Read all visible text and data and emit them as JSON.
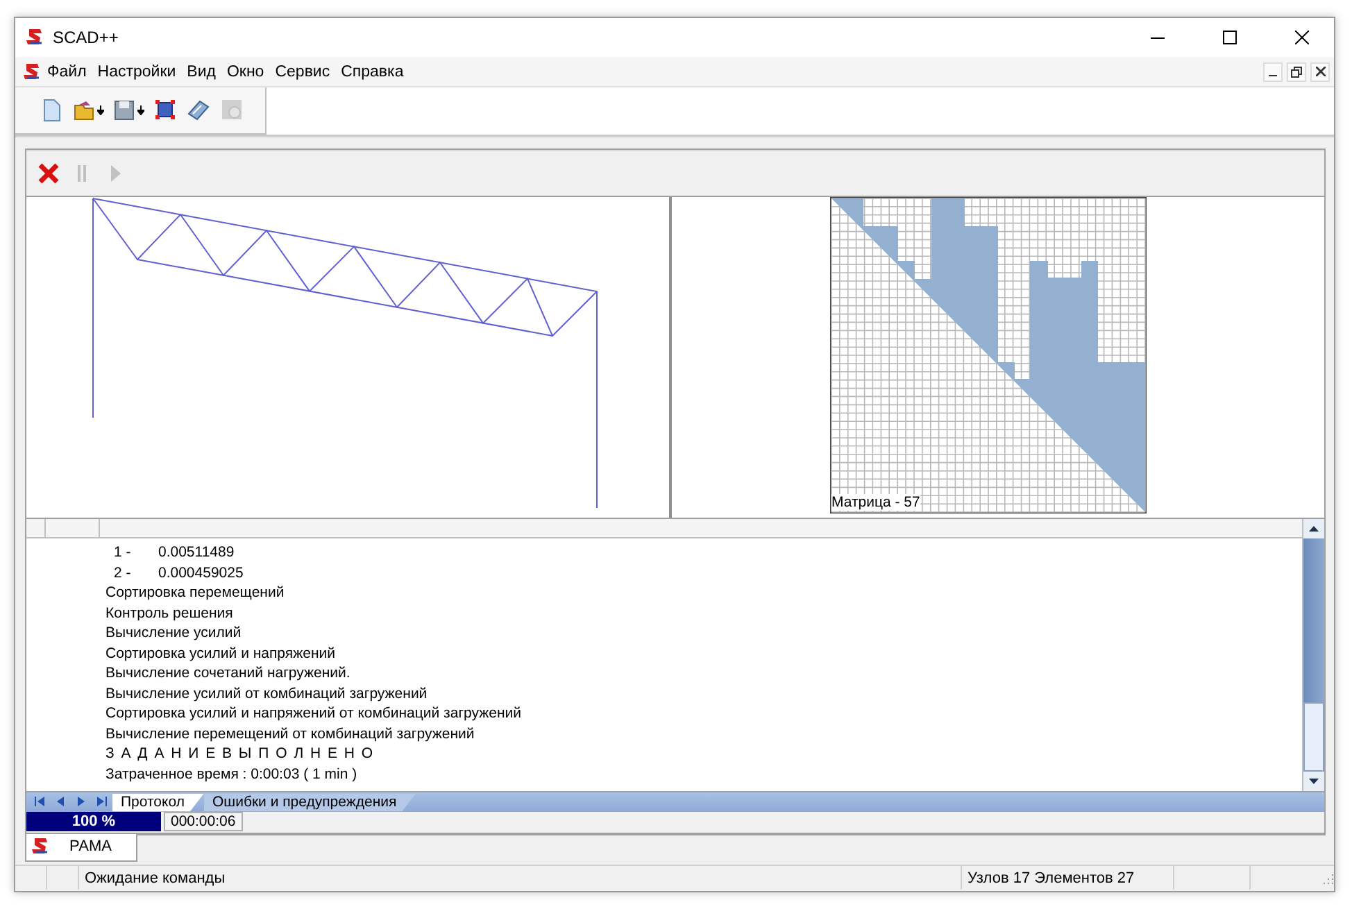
{
  "window": {
    "title": "SCAD++"
  },
  "menu": [
    {
      "label": "Файл"
    },
    {
      "label": "Настройки"
    },
    {
      "label": "Вид"
    },
    {
      "label": "Окно"
    },
    {
      "label": "Сервис"
    },
    {
      "label": "Справка"
    }
  ],
  "main_toolbar": [
    {
      "kind": "new",
      "disabled": false
    },
    {
      "kind": "open",
      "disabled": false
    },
    {
      "kind": "save",
      "disabled": false
    },
    {
      "kind": "frame",
      "disabled": false
    },
    {
      "kind": "print",
      "disabled": false
    },
    {
      "kind": "settings",
      "disabled": true
    }
  ],
  "run_toolbar": [
    {
      "kind": "stop",
      "disabled": false
    },
    {
      "kind": "pause",
      "disabled": true
    },
    {
      "kind": "play",
      "disabled": true
    }
  ],
  "matrix": {
    "label": "Матрица - 57"
  },
  "log": {
    "lines": [
      {
        "kind": "value",
        "index": "1 -",
        "value": "0.00511489"
      },
      {
        "kind": "value",
        "index": "2 -",
        "value": "0.000459025"
      },
      {
        "kind": "text",
        "text": "Сортировка перемещений"
      },
      {
        "kind": "text",
        "text": "Контроль решения"
      },
      {
        "kind": "text",
        "text": "Вычисление усилий"
      },
      {
        "kind": "text",
        "text": "Сортировка усилий и напряжений"
      },
      {
        "kind": "text",
        "text": "Вычисление сочетаний нагружений."
      },
      {
        "kind": "text",
        "text": "Вычисление усилий от комбинаций загружений"
      },
      {
        "kind": "text",
        "text": "Сортировка усилий и напряжений от комбинаций загружений"
      },
      {
        "kind": "text",
        "text": "Вычисление перемещений от комбинаций загружений"
      },
      {
        "kind": "heading",
        "text": "З А Д А Н И Е   В Ы П О Л Н Е Н О"
      },
      {
        "kind": "text",
        "text": "Затраченное время : 0:00:03 ( 1 min )"
      }
    ]
  },
  "log_tabs": [
    {
      "label": "Протокол",
      "selected": true
    },
    {
      "label": "Ошибки и предупреждения",
      "selected": false
    }
  ],
  "progress": {
    "label": "100 %",
    "level": 1,
    "elapsed": "000:00:06"
  },
  "documents": [
    {
      "label": "РАМА",
      "selected": true
    }
  ],
  "status_bar": {
    "message": "Ожидание команды",
    "counts": "Узлов 17 Элементов 27"
  }
}
